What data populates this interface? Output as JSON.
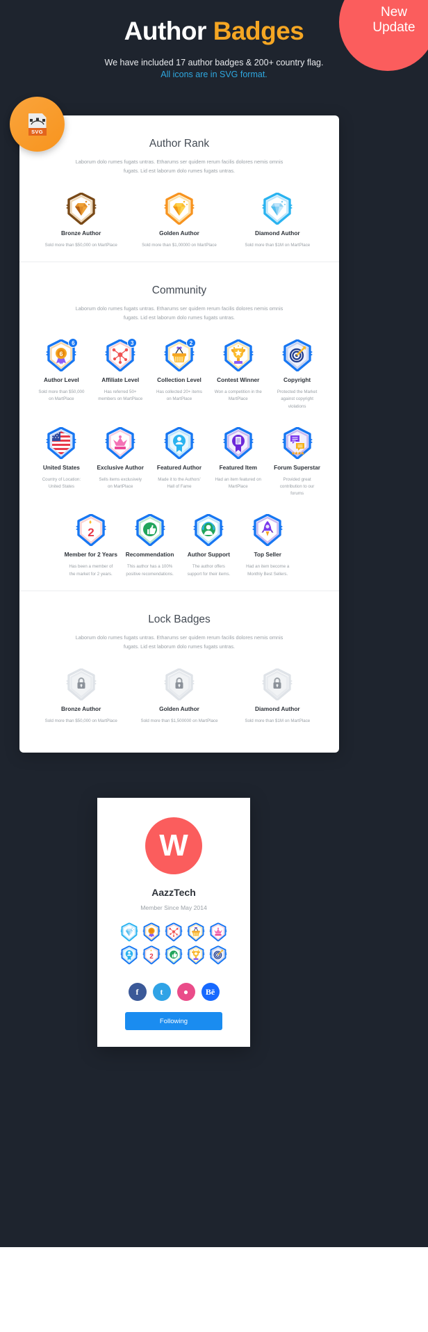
{
  "header": {
    "title_main": "Author",
    "title_accent": "Badges",
    "sub1": "We have included 17 author badges & 200+ country flag.",
    "sub2": "All icons are in SVG format.",
    "new_badge_line1": "New",
    "new_badge_line2": "Update",
    "svg_chip_label": "SVG",
    "accent_color": "#f5a623",
    "link_color": "#2fa8e0",
    "new_badge_color": "#fb5d5d"
  },
  "lorem": "Laborum dolo rumes fugats untras. Etharums ser quidem rerum facilis dolores nemis omnis fugats. Lid est laborum dolo rumes fugats untras.",
  "sections": [
    {
      "title": "Author Rank",
      "items": [
        {
          "label": "Bronze Author",
          "desc": "Sold more than $50,000 on MartPlace",
          "icon": "diamond-bronze-icon"
        },
        {
          "label": "Golden Author",
          "desc": "Sold more than $1,00000 on MartPlace",
          "icon": "diamond-golden-icon"
        },
        {
          "label": "Diamond Author",
          "desc": "Sold more than $1M on MartPlace",
          "icon": "diamond-blue-icon"
        }
      ]
    },
    {
      "title": "Community",
      "items": [
        {
          "label": "Author Level",
          "desc": "Sold more than $50,000 on MartPlace",
          "icon": "rosette-icon",
          "level": "6"
        },
        {
          "label": "Affiliate Level",
          "desc": "Has referred 50+ members on MartPlace",
          "icon": "network-icon",
          "level": "3"
        },
        {
          "label": "Collection Level",
          "desc": "Has collected 20+ items on MartPlace",
          "icon": "basket-icon",
          "level": "2"
        },
        {
          "label": "Contest Winner",
          "desc": "Won a competition in the MartPlace",
          "icon": "trophy-icon"
        },
        {
          "label": "Copyright",
          "desc": "Protected the Market against copyright violations",
          "icon": "target-icon"
        },
        {
          "label": "United States",
          "desc": "Country of Location: United States",
          "icon": "us-flag-icon"
        },
        {
          "label": "Exclusive Author",
          "desc": "Sells items exclusively on MartPlace",
          "icon": "crown-icon"
        },
        {
          "label": "Featured Author",
          "desc": "Made it to the Authors' Hall of Fame",
          "icon": "person-ribbon-icon"
        },
        {
          "label": "Featured Item",
          "desc": "Had an item featured on MartPlace",
          "icon": "document-ribbon-icon"
        },
        {
          "label": "Forum Superstar",
          "desc": "Provided great contribution to our forums",
          "icon": "chat-stars-icon"
        },
        {
          "label": "Member for 2 Years",
          "desc": "Has been a member of the market for 2 years.",
          "icon": "birthday-candle-icon"
        },
        {
          "label": "Recommendation",
          "desc": "This author has a 100% positive recomendations.",
          "icon": "thumbs-up-icon"
        },
        {
          "label": "Author Support",
          "desc": "The author offers support for their items.",
          "icon": "headset-icon"
        },
        {
          "label": "Top Seller",
          "desc": "Had an item become a Monthly Best Sellers.",
          "icon": "rocket-icon"
        }
      ]
    },
    {
      "title": "Lock Badges",
      "items": [
        {
          "label": "Bronze Author",
          "desc": "Sold more than $50,000 on MartPlace",
          "icon": "lock-icon"
        },
        {
          "label": "Golden Author",
          "desc": "Sold more than $1,500000 on MartPlace",
          "icon": "lock-icon"
        },
        {
          "label": "Diamond Author",
          "desc": "Sold more than $1M on MartPlace",
          "icon": "lock-icon"
        }
      ]
    }
  ],
  "profile": {
    "avatar_letter": "W",
    "name": "AazzTech",
    "member_since": "Member Since May 2014",
    "avatar_color": "#fb5d5d",
    "follow_label": "Following",
    "follow_color": "#1a8cf0",
    "mini_badges": [
      "diamond-blue-icon",
      "rosette-icon",
      "network-icon",
      "basket-icon",
      "crown-icon",
      "person-ribbon-icon",
      "birthday-candle-icon",
      "thumbs-up-icon",
      "trophy-icon",
      "target-icon"
    ],
    "socials": [
      {
        "name": "facebook-icon",
        "glyph": "f",
        "color": "#3b5998"
      },
      {
        "name": "twitter-icon",
        "glyph": "t",
        "color": "#30a3e6"
      },
      {
        "name": "dribbble-icon",
        "glyph": "●",
        "color": "#ea4c89"
      },
      {
        "name": "behance-icon",
        "glyph": "Bē",
        "color": "#1769ff"
      }
    ]
  }
}
